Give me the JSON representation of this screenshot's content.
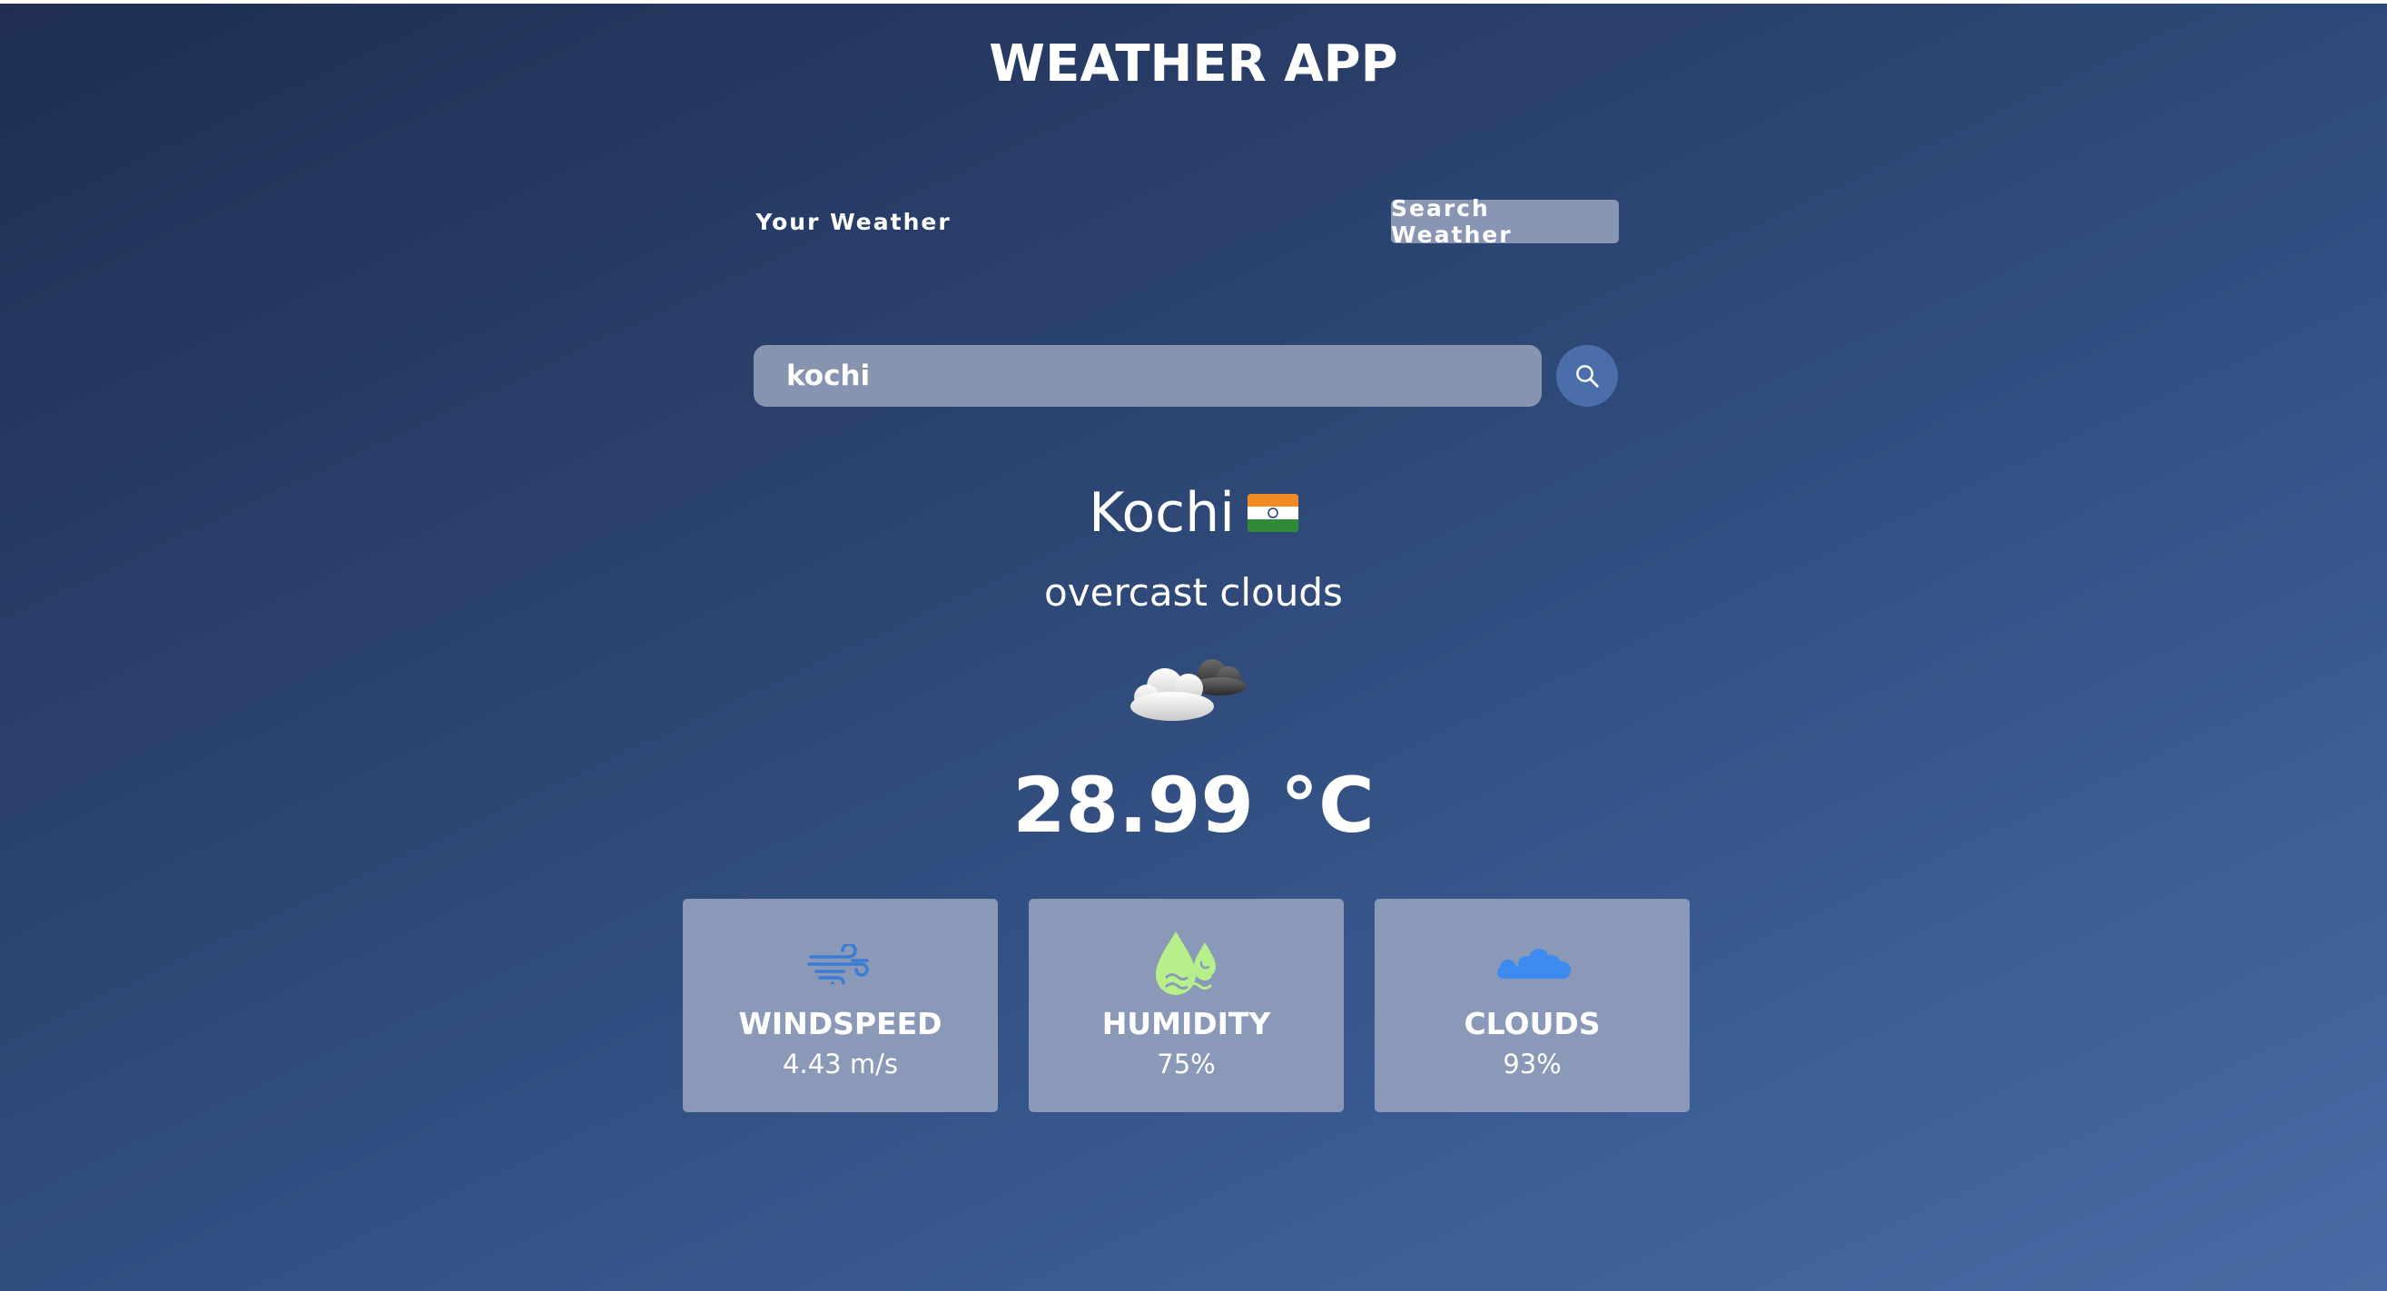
{
  "app": {
    "title": "WEATHER APP"
  },
  "tabs": {
    "your_weather": "Your Weather",
    "search_weather": "Search Weather"
  },
  "search": {
    "value": "kochi"
  },
  "weather": {
    "city": "Kochi",
    "flag": "🇮🇳",
    "description": "overcast clouds",
    "icon": "overcast-clouds-icon",
    "temperature": "28.99 °C"
  },
  "stats": {
    "windspeed": {
      "label": "WINDSPEED",
      "value": "4.43 m/s",
      "icon": "wind-icon"
    },
    "humidity": {
      "label": "HUMIDITY",
      "value": "75%",
      "icon": "humidity-icon"
    },
    "clouds": {
      "label": "CLOUDS",
      "value": "93%",
      "icon": "cloud-icon"
    }
  },
  "colors": {
    "background_top": "#1f2e52",
    "background_bottom": "#4a6aa5",
    "card": "#8b99b8",
    "search_button": "#4b6eaa",
    "humidity_icon": "#b7ef8a",
    "wind_icon": "#3a7bd5",
    "cloud_icon": "#3d8bf0"
  }
}
